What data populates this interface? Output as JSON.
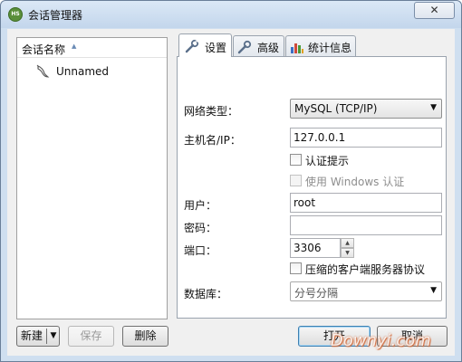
{
  "window": {
    "title": "会话管理器",
    "app_icon_text": "HS",
    "close_label": "✕"
  },
  "tree": {
    "header": "会话名称",
    "sort_icon": "sort-ascending-icon",
    "items": [
      {
        "label": "Unnamed",
        "icon": "dolphin-icon"
      }
    ]
  },
  "left_buttons": {
    "new": "新建",
    "new_arrow": "▼",
    "save": "保存",
    "delete": "删除"
  },
  "tabs": [
    {
      "label": "设置",
      "icon": "wrench-icon",
      "active": true
    },
    {
      "label": "高级",
      "icon": "wrench-icon",
      "active": false
    },
    {
      "label": "统计信息",
      "icon": "bar-chart-icon",
      "active": false
    }
  ],
  "settings": {
    "network_type_label": "网络类型：",
    "network_type_value": "MySQL (TCP/IP)",
    "host_label": "主机名/IP：",
    "host_value": "127.0.0.1",
    "auth_prompt_label": "认证提示",
    "windows_auth_label": "使用 Windows 认证",
    "user_label": "用户：",
    "user_value": "root",
    "password_label": "密码：",
    "password_value": "",
    "port_label": "端口：",
    "port_value": "3306",
    "compress_label": "压缩的客户端服务器协议",
    "database_label": "数据库：",
    "database_value": "分号分隔"
  },
  "dialog_buttons": {
    "open": "打开",
    "cancel": "取消"
  },
  "watermark": "Downyi.com",
  "colors": {
    "frame": "#cfdff0",
    "client": "#f0f0f0",
    "accent_border": "#3c7fb1"
  }
}
